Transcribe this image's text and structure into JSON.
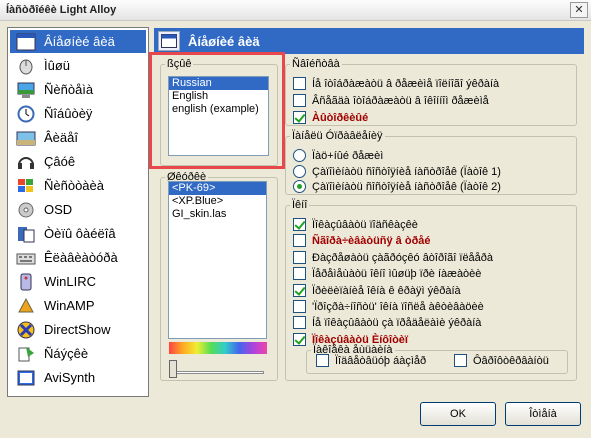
{
  "window": {
    "title": "Íàñòðîéêè Light Alloy",
    "close_symbol": "✕"
  },
  "sidebar": {
    "items": [
      {
        "label": "Âíåøíèé âèä",
        "icon": "appearance-icon"
      },
      {
        "label": "Ìûøü",
        "icon": "mouse-icon"
      },
      {
        "label": "Ñèñòåìà",
        "icon": "system-icon"
      },
      {
        "label": "Ñîáûòèÿ",
        "icon": "clock-icon"
      },
      {
        "label": "Âèäåî",
        "icon": "video-icon"
      },
      {
        "label": "Çâóê",
        "icon": "headphones-icon"
      },
      {
        "label": "Ñèñòòàèà",
        "icon": "windows-flag-icon"
      },
      {
        "label": "OSD",
        "icon": "osd-icon"
      },
      {
        "label": "Òèïû ôàéëîâ",
        "icon": "file-types-icon"
      },
      {
        "label": "Êëàâèàòóðà",
        "icon": "keyboard-icon"
      },
      {
        "label": "WinLIRC",
        "icon": "remote-icon"
      },
      {
        "label": "WinAMP",
        "icon": "winamp-icon"
      },
      {
        "label": "DirectShow",
        "icon": "directshow-icon"
      },
      {
        "label": "Ñáýçêè",
        "icon": "associations-icon"
      },
      {
        "label": "AviSynth",
        "icon": "avisynth-icon"
      }
    ],
    "selected_index": 0
  },
  "header": {
    "title": "Âíåøíèé âèä"
  },
  "language_group": {
    "legend": "ßçûê",
    "items": [
      "Russian",
      "English",
      "english (example)"
    ],
    "selected_index": 0
  },
  "skins_group": {
    "legend": "Øêóðêè",
    "items": [
      "<PK-69>",
      "<XP.Blue>",
      "GI_skin.las"
    ],
    "selected_index": 0
  },
  "states_group": {
    "legend": "Ñâîéñòâà",
    "options": [
      {
        "label": "Íå îòîáðàæàòü â ðåæèìå ïîëíîãî ýêðàíà",
        "checked": false,
        "red": false
      },
      {
        "label": "Âñåãäà îòîáðàæàòü â îêîííîì ðåæèìå",
        "checked": false,
        "red": false
      },
      {
        "label": "Àûòîðêèûé",
        "checked": true,
        "red": true
      }
    ]
  },
  "panel_group": {
    "legend": "Ïàíåëü Óïðàâëåíèÿ",
    "options": [
      {
        "label": "Ïàö+íûé ðåæèì",
        "checked": false
      },
      {
        "label": "Çàïîìèíàòü ñîñòîÿíèå íàñòðîåê (Ïàòîê 1)",
        "checked": false
      },
      {
        "label": "Çàïîìèíàòü ñîñòîÿíèå íàñòðîåê (Ïàòîê 2)",
        "checked": true
      }
    ]
  },
  "other_group": {
    "legend": "Ïêíî",
    "options": [
      {
        "label": "Ïîêàçûâàòü ïîäñêàçêè",
        "checked": true,
        "red": false
      },
      {
        "label": "Ñãîðà÷èâàòüñÿ â òðåé",
        "checked": false,
        "red": true
      },
      {
        "label": "Ðàçðåøàòü çàãðóçêó âòîðîãî ïëååðà",
        "checked": false,
        "red": false
      },
      {
        "label": "Ïåðåìåùàòü îêíî ìûøüþ ïðè íàæàòèè",
        "checked": false,
        "red": false
      },
      {
        "label": "Ïðèëèïàíèå îêíà ê êðàÿì ýêðàíà",
        "checked": true,
        "red": false
      },
      {
        "label": "'Ïðîçðà÷íîñòü' îêíà ïîñëå àêòèâàöèè",
        "checked": false,
        "red": false
      },
      {
        "label": "Íå ïîêàçûâàòü çà ïðåäåëàìè ýêðàíà",
        "checked": false,
        "red": false
      },
      {
        "label": "Ïîêàçûâàòü Èíôîòèï",
        "checked": true,
        "red": true
      }
    ]
  },
  "tooltip_group": {
    "legend": "Ïàêîåêà åùüàèíà",
    "options": [
      {
        "label": "Ïîäâåòâüóþ áàçìåð",
        "checked": false
      },
      {
        "label": "Ôâðîôòêðâàíòü",
        "checked": false
      }
    ]
  },
  "buttons": {
    "ok": "OK",
    "cancel": "Îòìåíà"
  }
}
